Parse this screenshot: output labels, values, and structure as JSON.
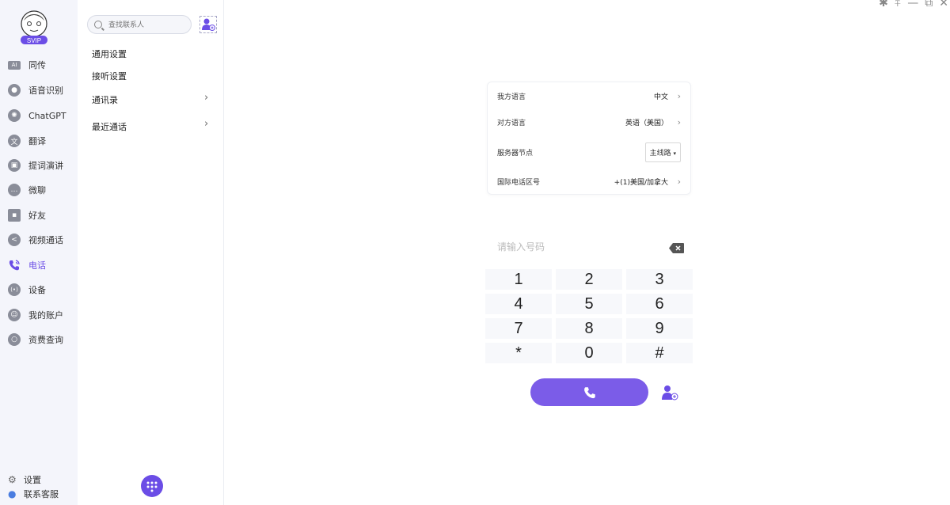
{
  "window": {
    "controls": [
      "✱",
      "⍏",
      "—",
      "⧉",
      "✕"
    ]
  },
  "nav": {
    "badge": "SVIP",
    "items": [
      {
        "label": "同传",
        "icon": "ai-icon"
      },
      {
        "label": "语音识别",
        "icon": "microphone-icon"
      },
      {
        "label": "ChatGPT",
        "icon": "chatgpt-icon"
      },
      {
        "label": "翻译",
        "icon": "translate-icon"
      },
      {
        "label": "提词演讲",
        "icon": "teleprompter-icon"
      },
      {
        "label": "微聊",
        "icon": "chat-icon"
      },
      {
        "label": "好友",
        "icon": "contact-card-icon"
      },
      {
        "label": "视频通话",
        "icon": "share-icon"
      },
      {
        "label": "电话",
        "icon": "phone-icon"
      },
      {
        "label": "设备",
        "icon": "device-icon"
      },
      {
        "label": "我的账户",
        "icon": "account-icon"
      },
      {
        "label": "资费查询",
        "icon": "search-icon"
      }
    ],
    "settings": "设置",
    "support": "联系客服"
  },
  "sidebar": {
    "search_placeholder": "查找联系人",
    "menu": [
      {
        "label": "通用设置",
        "arrow": false
      },
      {
        "label": "接听设置",
        "arrow": false
      },
      {
        "label": "通讯录",
        "arrow": true
      },
      {
        "label": "最近通话",
        "arrow": true
      }
    ]
  },
  "settings": {
    "my_language": {
      "label": "我方语言",
      "value": "中文"
    },
    "their_language": {
      "label": "对方语言",
      "value": "英语（美国）"
    },
    "server_node": {
      "label": "服务器节点",
      "value": "主线路"
    },
    "country_code": {
      "label": "国际电话区号",
      "value": "+(1)美国/加拿大"
    }
  },
  "dialer": {
    "placeholder": "请输入号码",
    "keys": [
      "1",
      "2",
      "3",
      "4",
      "5",
      "6",
      "7",
      "8",
      "9",
      "*",
      "0",
      "#"
    ]
  },
  "colors": {
    "accent": "#6b4de6",
    "call": "#7b5ce8"
  }
}
